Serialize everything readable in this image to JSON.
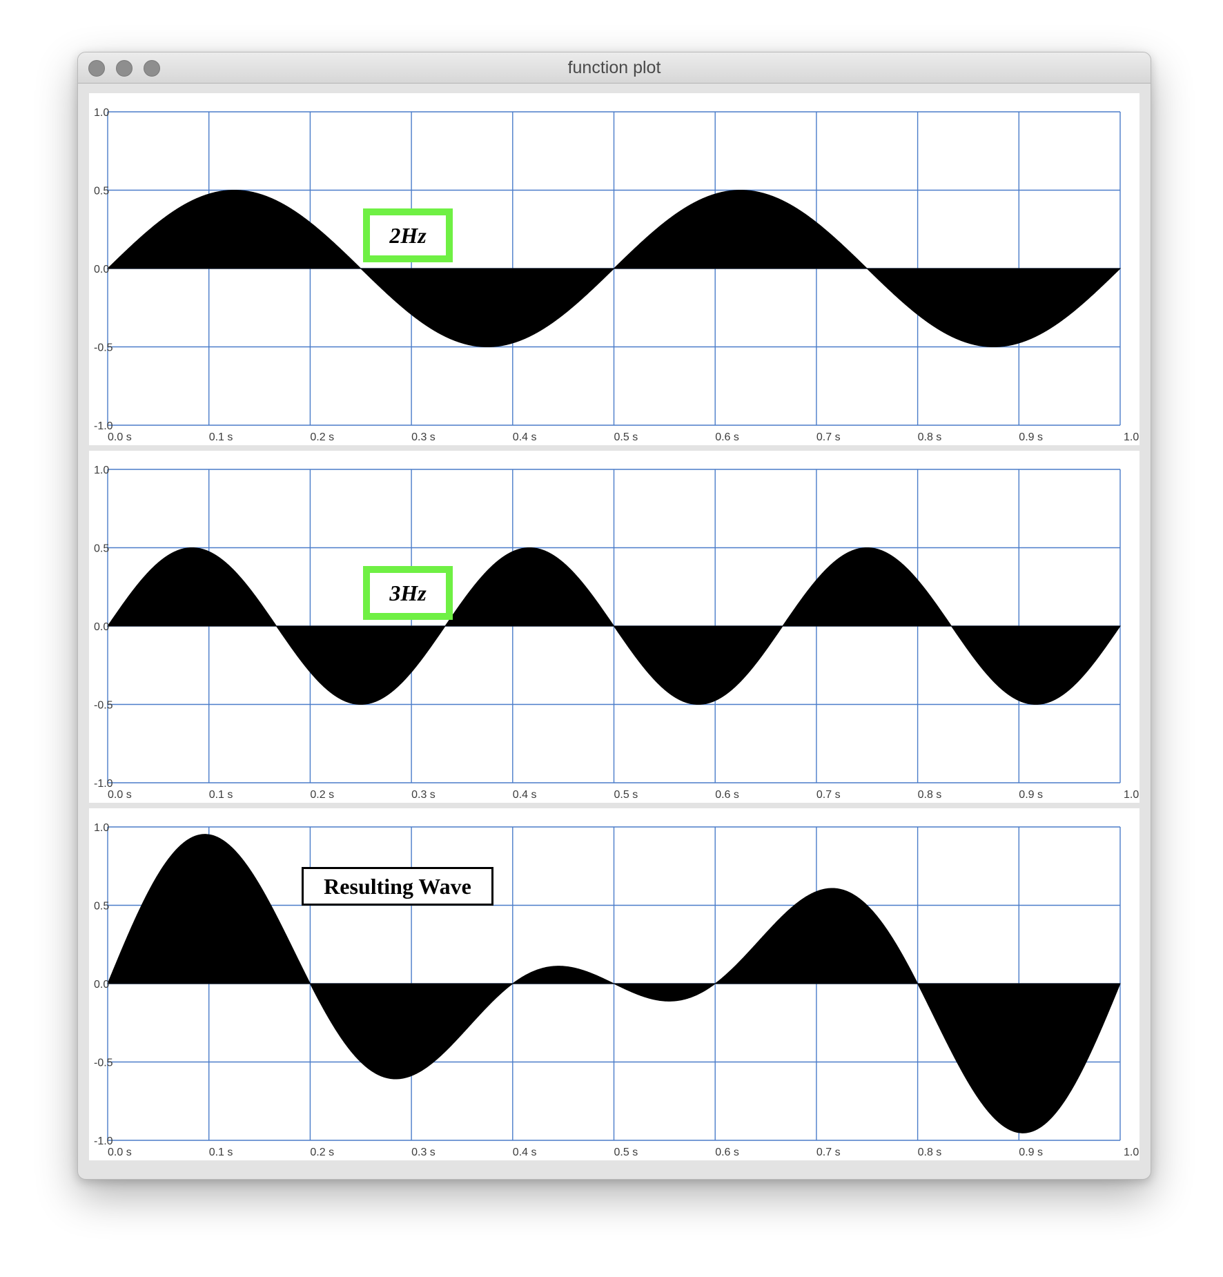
{
  "window": {
    "title": "function plot"
  },
  "colors": {
    "grid": "#4a7cc9",
    "fill": "#000000",
    "label_border_green": "#6ff044",
    "label_border_black": "#000000"
  },
  "panels": [
    {
      "label": "2Hz",
      "label_style": "green"
    },
    {
      "label": "3Hz",
      "label_style": "green"
    },
    {
      "label": "Resulting Wave",
      "label_style": "black"
    }
  ],
  "chart_data": [
    {
      "type": "area",
      "function": "0.5*sin(2*pi*2*t)",
      "frequency_hz": 2,
      "amplitude": 0.5,
      "xlim": [
        0,
        1
      ],
      "ylim": [
        -1,
        1
      ],
      "x_ticks": [
        0,
        0.1,
        0.2,
        0.3,
        0.4,
        0.5,
        0.6,
        0.7,
        0.8,
        0.9,
        1.0
      ],
      "x_tick_labels": [
        "0.0 s",
        "0.1 s",
        "0.2 s",
        "0.3 s",
        "0.4 s",
        "0.5 s",
        "0.6 s",
        "0.7 s",
        "0.8 s",
        "0.9 s",
        "1.0"
      ],
      "y_ticks": [
        1.0,
        0.5,
        0.0,
        -0.5,
        -1.0
      ],
      "y_tick_labels": [
        "1.0",
        "0.5",
        "0.0",
        "-0.5",
        "-1.0"
      ],
      "grid": true,
      "annotation": "2Hz"
    },
    {
      "type": "area",
      "function": "0.5*sin(2*pi*3*t)",
      "frequency_hz": 3,
      "amplitude": 0.5,
      "xlim": [
        0,
        1
      ],
      "ylim": [
        -1,
        1
      ],
      "x_ticks": [
        0,
        0.1,
        0.2,
        0.3,
        0.4,
        0.5,
        0.6,
        0.7,
        0.8,
        0.9,
        1.0
      ],
      "x_tick_labels": [
        "0.0 s",
        "0.1 s",
        "0.2 s",
        "0.3 s",
        "0.4 s",
        "0.5 s",
        "0.6 s",
        "0.7 s",
        "0.8 s",
        "0.9 s",
        "1.0"
      ],
      "y_ticks": [
        1.0,
        0.5,
        0.0,
        -0.5,
        -1.0
      ],
      "y_tick_labels": [
        "1.0",
        "0.5",
        "0.0",
        "-0.5",
        "-1.0"
      ],
      "grid": true,
      "annotation": "3Hz"
    },
    {
      "type": "area",
      "function": "0.5*sin(2*pi*2*t) + 0.5*sin(2*pi*3*t)",
      "components_hz": [
        2,
        3
      ],
      "amplitude": 0.5,
      "xlim": [
        0,
        1
      ],
      "ylim": [
        -1,
        1
      ],
      "x_ticks": [
        0,
        0.1,
        0.2,
        0.3,
        0.4,
        0.5,
        0.6,
        0.7,
        0.8,
        0.9,
        1.0
      ],
      "x_tick_labels": [
        "0.0 s",
        "0.1 s",
        "0.2 s",
        "0.3 s",
        "0.4 s",
        "0.5 s",
        "0.6 s",
        "0.7 s",
        "0.8 s",
        "0.9 s",
        "1.0"
      ],
      "y_ticks": [
        1.0,
        0.5,
        0.0,
        -0.5,
        -1.0
      ],
      "y_tick_labels": [
        "1.0",
        "0.5",
        "0.0",
        "-0.5",
        "-1.0"
      ],
      "grid": true,
      "annotation": "Resulting Wave"
    }
  ]
}
